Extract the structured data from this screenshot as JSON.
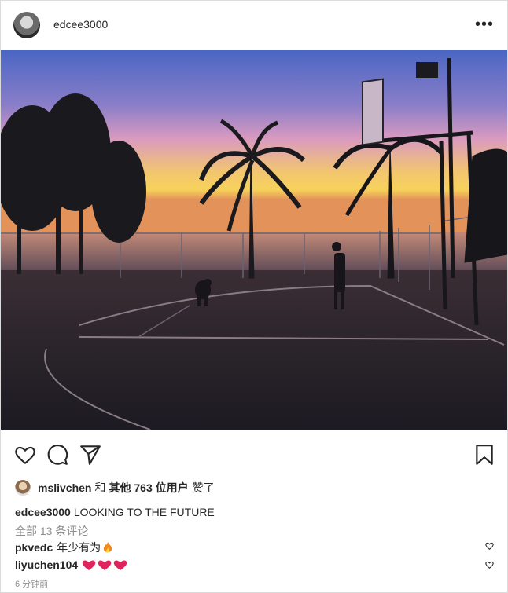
{
  "header": {
    "username": "edcee3000",
    "more_label": "•••"
  },
  "photo": {
    "description_icon": "sunset-basketball-court-photo"
  },
  "actions": {
    "like_icon": "heart-outline-icon",
    "comment_icon": "comment-icon",
    "share_icon": "send-icon",
    "save_icon": "bookmark-icon"
  },
  "likes": {
    "user": "mslivchen",
    "and": "和",
    "others": "其他 763 位用户",
    "suffix": "赞了"
  },
  "caption": {
    "username": "edcee3000",
    "text": "LOOKING TO THE FUTURE"
  },
  "all_comments": "全部 13 条评论",
  "comments": [
    {
      "username": "pkvedc",
      "text": "年少有为",
      "emoji": "fire"
    },
    {
      "username": "liyuchen104",
      "text": "",
      "emoji": "three-hearts"
    }
  ],
  "time": "6 分钟前",
  "colors": {
    "text": "#262626",
    "muted": "#8e8e8e",
    "heart_red": "#e0245e",
    "border": "#dbdbdb"
  }
}
